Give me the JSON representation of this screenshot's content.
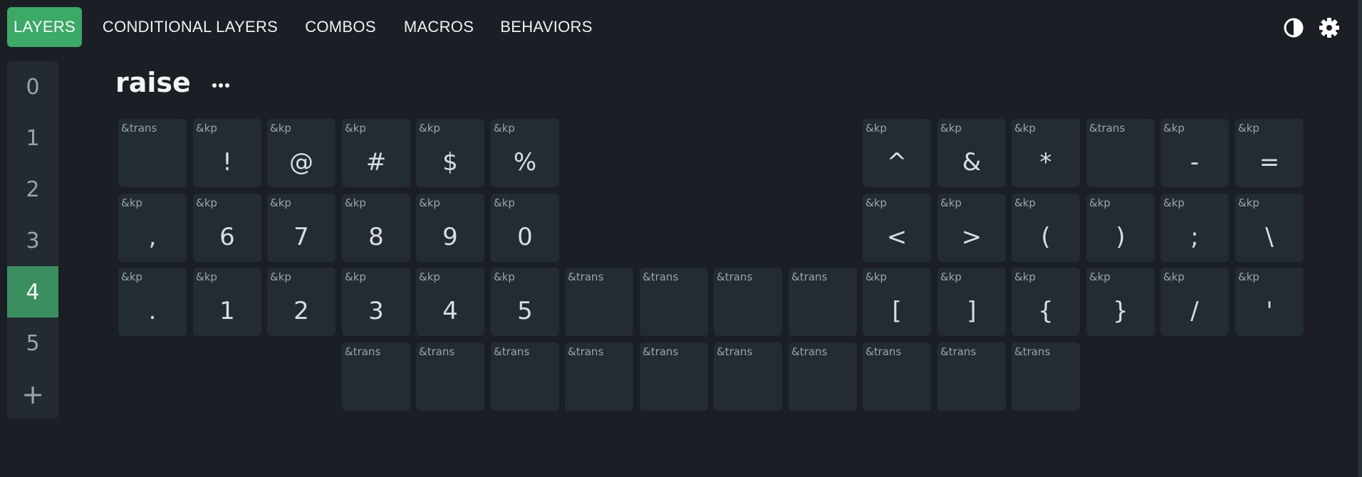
{
  "nav": {
    "tabs": [
      {
        "label": "LAYERS",
        "active": true
      },
      {
        "label": "CONDITIONAL LAYERS",
        "active": false
      },
      {
        "label": "COMBOS",
        "active": false
      },
      {
        "label": "MACROS",
        "active": false
      },
      {
        "label": "BEHAVIORS",
        "active": false
      }
    ],
    "icons": [
      "contrast-icon",
      "gear-icon"
    ]
  },
  "sidebar": {
    "layers": [
      "0",
      "1",
      "2",
      "3",
      "4",
      "5"
    ],
    "active_layer": "4",
    "add_label": "+"
  },
  "layer": {
    "name": "raise",
    "menu_icon": "more-icon"
  },
  "colors": {
    "accent": "#3aaa66",
    "active_layer_bg": "#3b8f5e",
    "background": "#1b1f25",
    "key_bg": "#232b33"
  },
  "keys": [
    {
      "b": "&trans",
      "l": ""
    },
    {
      "b": "&kp",
      "l": "!"
    },
    {
      "b": "&kp",
      "l": "@"
    },
    {
      "b": "&kp",
      "l": "#"
    },
    {
      "b": "&kp",
      "l": "$"
    },
    {
      "b": "&kp",
      "l": "%"
    },
    {
      "b": "&kp",
      "l": "^"
    },
    {
      "b": "&kp",
      "l": "&"
    },
    {
      "b": "&kp",
      "l": "*"
    },
    {
      "b": "&trans",
      "l": ""
    },
    {
      "b": "&kp",
      "l": "-"
    },
    {
      "b": "&kp",
      "l": "="
    },
    {
      "b": "&kp",
      "l": ","
    },
    {
      "b": "&kp",
      "l": "6"
    },
    {
      "b": "&kp",
      "l": "7"
    },
    {
      "b": "&kp",
      "l": "8"
    },
    {
      "b": "&kp",
      "l": "9"
    },
    {
      "b": "&kp",
      "l": "0"
    },
    {
      "b": "&kp",
      "l": "<"
    },
    {
      "b": "&kp",
      "l": ">"
    },
    {
      "b": "&kp",
      "l": "("
    },
    {
      "b": "&kp",
      "l": ")"
    },
    {
      "b": "&kp",
      "l": ";"
    },
    {
      "b": "&kp",
      "l": "\\"
    },
    {
      "b": "&kp",
      "l": "."
    },
    {
      "b": "&kp",
      "l": "1"
    },
    {
      "b": "&kp",
      "l": "2"
    },
    {
      "b": "&kp",
      "l": "3"
    },
    {
      "b": "&kp",
      "l": "4"
    },
    {
      "b": "&kp",
      "l": "5"
    },
    {
      "b": "&trans",
      "l": ""
    },
    {
      "b": "&trans",
      "l": ""
    },
    {
      "b": "&trans",
      "l": ""
    },
    {
      "b": "&trans",
      "l": ""
    },
    {
      "b": "&kp",
      "l": "["
    },
    {
      "b": "&kp",
      "l": "]"
    },
    {
      "b": "&kp",
      "l": "{"
    },
    {
      "b": "&kp",
      "l": "}"
    },
    {
      "b": "&kp",
      "l": "/"
    },
    {
      "b": "&kp",
      "l": "'"
    },
    {
      "b": "&trans",
      "l": ""
    },
    {
      "b": "&trans",
      "l": ""
    },
    {
      "b": "&trans",
      "l": ""
    },
    {
      "b": "&trans",
      "l": ""
    },
    {
      "b": "&trans",
      "l": ""
    },
    {
      "b": "&trans",
      "l": ""
    },
    {
      "b": "&trans",
      "l": ""
    },
    {
      "b": "&trans",
      "l": ""
    },
    {
      "b": "&trans",
      "l": ""
    },
    {
      "b": "&trans",
      "l": ""
    }
  ]
}
